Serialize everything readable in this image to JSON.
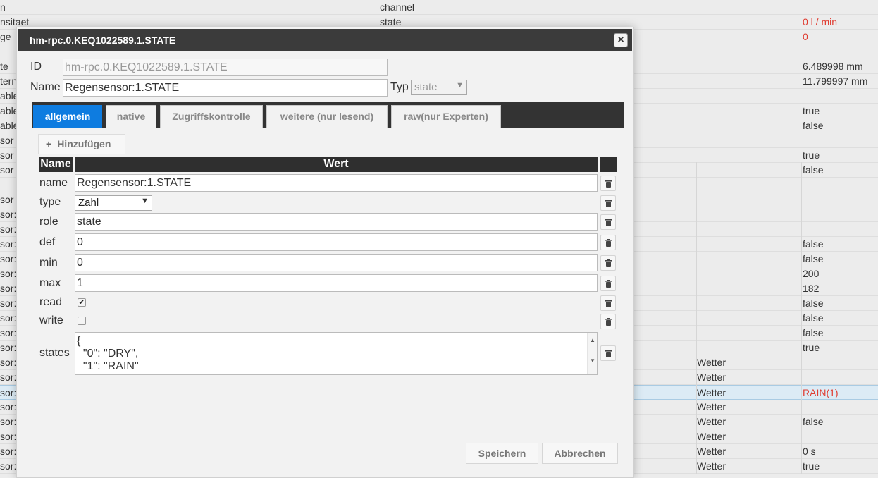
{
  "background": {
    "rows": [
      {
        "c0": "n",
        "c1": "channel",
        "c2": "",
        "c3": "",
        "red": false
      },
      {
        "c0": "nsitaet",
        "c1": "state",
        "c2": "",
        "c3": "0 l / min",
        "red": true
      },
      {
        "c0": "ge_",
        "c1": "",
        "c2": "",
        "c3": "0",
        "red": true
      },
      {
        "c0": "",
        "c1": "",
        "c2": "",
        "c3": "",
        "red": false
      },
      {
        "c0": "te",
        "c1": "",
        "c2": "",
        "c3": "6.489998 mm",
        "red": false
      },
      {
        "c0": "tern",
        "c1": "",
        "c2": "",
        "c3": "11.799997 mm",
        "red": false
      },
      {
        "c0": "able",
        "c1": "",
        "c2": "",
        "c3": "",
        "red": false
      },
      {
        "c0": "able",
        "c1": "",
        "c2": "",
        "c3": "true",
        "red": false
      },
      {
        "c0": "able",
        "c1": "",
        "c2": "",
        "c3": "false",
        "red": false
      },
      {
        "c0": "sor l",
        "c1": "",
        "c2": "",
        "c3": "",
        "red": false
      },
      {
        "c0": "sor l",
        "c1": "",
        "c2": "",
        "c3": "true",
        "red": false
      },
      {
        "c0": "sor l",
        "c1": "",
        "c2": "",
        "c3": "false",
        "red": false
      },
      {
        "c0": "",
        "c1": "",
        "c2": "",
        "c3": "",
        "red": false
      },
      {
        "c0": "sor",
        "c1": "",
        "c2": "",
        "c3": "",
        "red": false
      },
      {
        "c0": "sor:(",
        "c1": "",
        "c2": "",
        "c3": "",
        "red": false
      },
      {
        "c0": "sor:(",
        "c1": "",
        "c2": "",
        "c3": "",
        "red": false
      },
      {
        "c0": "sor:(",
        "c1": "",
        "c2": "",
        "c3": "false",
        "red": false
      },
      {
        "c0": "sor:(",
        "c1": "",
        "c2": "",
        "c3": "false",
        "red": false
      },
      {
        "c0": "sor:(",
        "c1": "",
        "c2": "",
        "c3": "200",
        "red": false
      },
      {
        "c0": "sor:(",
        "c1": "",
        "c2": "",
        "c3": "182",
        "red": false
      },
      {
        "c0": "sor:(",
        "c1": "",
        "c2": "",
        "c3": "false",
        "red": false
      },
      {
        "c0": "sor:(",
        "c1": "",
        "c2": "",
        "c3": "false",
        "red": false
      },
      {
        "c0": "sor:(",
        "c1": "",
        "c2": "",
        "c3": "false",
        "red": false
      },
      {
        "c0": "sor:(",
        "c1": "",
        "c2": "",
        "c3": "true",
        "red": false
      },
      {
        "c0": "sor:",
        "c1": "",
        "c2": "Wetter",
        "c3": "",
        "red": false
      },
      {
        "c0": "sor:",
        "c1": "",
        "c2": "Wetter",
        "c3": "",
        "red": false
      },
      {
        "c0": "sor:",
        "c1": "",
        "c2": "Wetter",
        "c3": "RAIN(1)",
        "red": true,
        "selected": true
      },
      {
        "c0": "sor:",
        "c1": "",
        "c2": "Wetter",
        "c3": "",
        "red": false
      },
      {
        "c0": "sor:",
        "c1": "",
        "c2": "Wetter",
        "c3": "false",
        "red": false
      },
      {
        "c0": "sor:",
        "c1": "",
        "c2": "Wetter",
        "c3": "",
        "red": false
      },
      {
        "c0": "sor:",
        "c1": "",
        "c2": "Wetter",
        "c3": "0 s",
        "red": false
      },
      {
        "c0": "sor:",
        "c1": "",
        "c2": "Wetter",
        "c3": "true",
        "red": false
      }
    ]
  },
  "dialog": {
    "title": "hm-rpc.0.KEQ1022589.1.STATE",
    "close_label": "×",
    "id_label": "ID",
    "id_value": "hm-rpc.0.KEQ1022589.1.STATE",
    "name_label": "Name",
    "name_value": "Regensensor:1.STATE",
    "typ_label": "Typ",
    "typ_value": "state",
    "tabs": [
      {
        "label": "allgemein",
        "active": true
      },
      {
        "label": "native",
        "active": false
      },
      {
        "label": "Zugriffskontrolle",
        "active": false
      },
      {
        "label": "weitere (nur lesend)",
        "active": false
      },
      {
        "label": "raw(nur Experten)",
        "active": false
      }
    ],
    "add_label": "Hinzufügen",
    "add_icon": "plus-icon",
    "table": {
      "col_name": "Name",
      "col_value": "Wert",
      "rows": {
        "name": {
          "label": "name",
          "value": "Regensensor:1.STATE"
        },
        "type": {
          "label": "type",
          "value": "Zahl"
        },
        "role": {
          "label": "role",
          "value": "state"
        },
        "def": {
          "label": "def",
          "value": "0"
        },
        "min": {
          "label": "min",
          "value": "0"
        },
        "max": {
          "label": "max",
          "value": "1"
        },
        "read": {
          "label": "read",
          "checked": true
        },
        "write": {
          "label": "write",
          "checked": false
        },
        "states": {
          "label": "states",
          "value": "{\n  \"0\": \"DRY\",\n  \"1\": \"RAIN\""
        }
      },
      "delete_icon": "trash-icon"
    },
    "save_label": "Speichern",
    "cancel_label": "Abbrechen"
  },
  "colors": {
    "accent": "#0e7ce0",
    "titlebar": "#3b3b3b",
    "status_red": "#e03c31"
  }
}
